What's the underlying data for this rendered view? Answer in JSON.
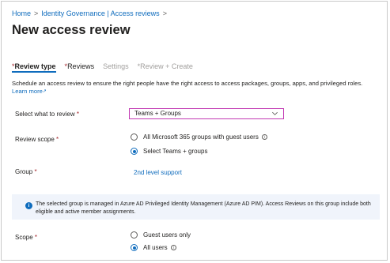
{
  "breadcrumb": {
    "items": [
      "Home",
      "Identity Governance | Access reviews"
    ],
    "separator": ">"
  },
  "page": {
    "title": "New access review",
    "more_label": "···"
  },
  "tabs": [
    {
      "label": "Review type",
      "required_mark": "*",
      "state": "active"
    },
    {
      "label": "Reviews",
      "required_mark": "*",
      "state": "normal"
    },
    {
      "label": "Settings",
      "required_mark": "",
      "state": "disabled"
    },
    {
      "label": "Review + Create",
      "required_mark": "*",
      "state": "disabled"
    }
  ],
  "description": {
    "text": "Schedule an access review to ensure the right people have the right access to access packages, groups, apps, and privileged roles.",
    "learn_more": "Learn more"
  },
  "form": {
    "select_review": {
      "label": "Select what to review",
      "required_mark": "*",
      "value": "Teams + Groups"
    },
    "review_scope": {
      "label": "Review scope",
      "required_mark": "*",
      "options": [
        {
          "label": "All Microsoft 365 groups with guest users",
          "checked": false,
          "has_info": true
        },
        {
          "label": "Select Teams + groups",
          "checked": true,
          "has_info": false
        }
      ]
    },
    "group": {
      "label": "Group",
      "required_mark": "*",
      "value": "2nd level support"
    },
    "scope": {
      "label": "Scope",
      "required_mark": "*",
      "options": [
        {
          "label": "Guest users only",
          "checked": false,
          "has_info": false
        },
        {
          "label": "All users",
          "checked": true,
          "has_info": true
        }
      ]
    }
  },
  "banner": {
    "icon": "info-icon",
    "message": "The selected group is managed in Azure AD Privileged Identity Management (Azure AD PIM). Access Reviews on this group include both eligible and active member assignments."
  },
  "colors": {
    "link": "#0f6cbd",
    "required": "#a4262c",
    "dropdown_border": "#c239b3",
    "banner_bg": "#f0f4fb"
  }
}
